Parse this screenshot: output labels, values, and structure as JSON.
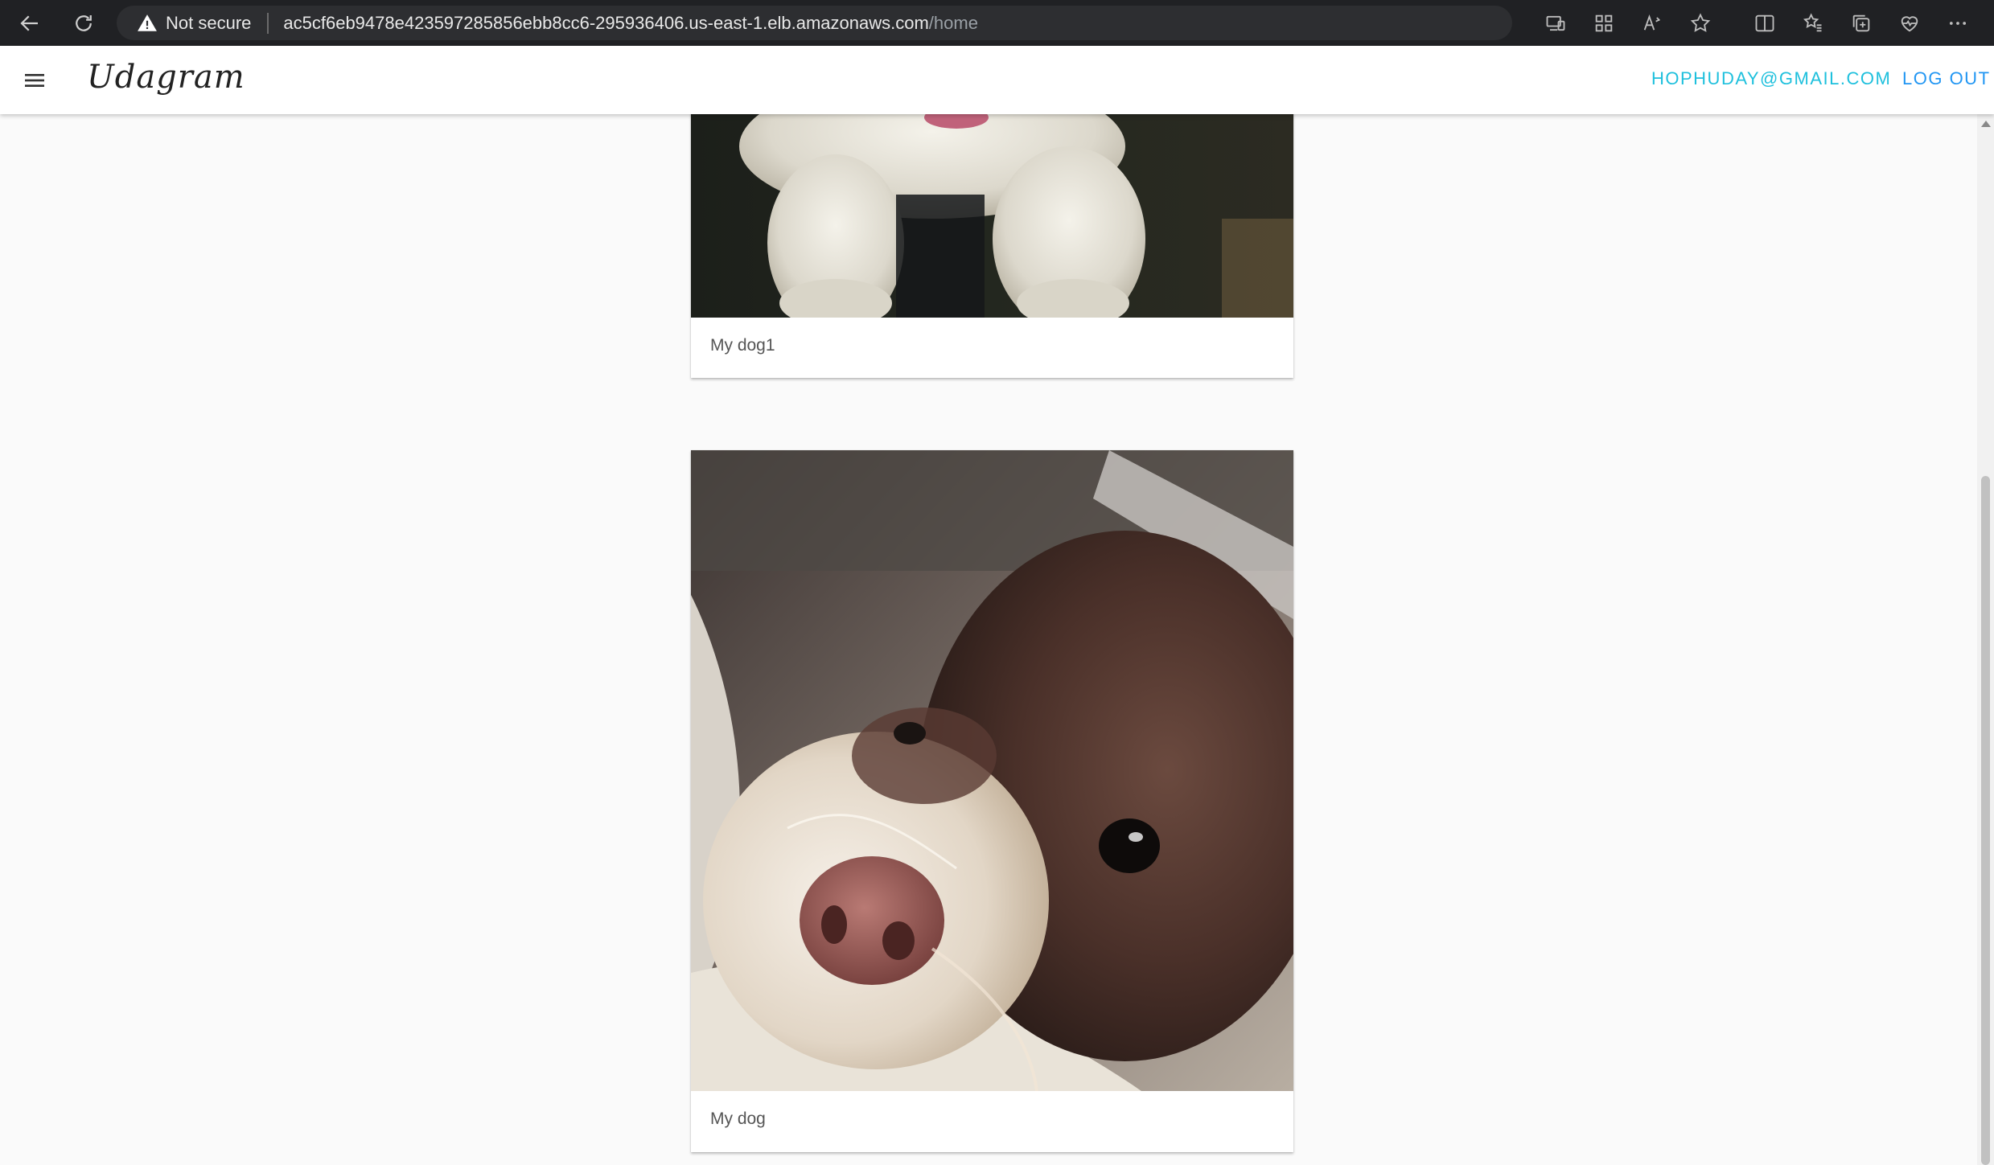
{
  "browser": {
    "security_label": "Not secure",
    "url_host": "ac5cf6eb9478e423597285856ebb8cc6-295936406.us-east-1.elb.amazonaws.com",
    "url_path": "/home"
  },
  "app": {
    "brand": "Udagram",
    "user_email": "HOPHUDAY@GMAIL.COM",
    "logout_label": "LOG OUT"
  },
  "feed": {
    "items": [
      {
        "caption": "My dog1"
      },
      {
        "caption": "My dog"
      }
    ]
  },
  "colors": {
    "email_link": "#1ec0dd",
    "logout_link": "#2196f3",
    "background": "#fafafa"
  }
}
